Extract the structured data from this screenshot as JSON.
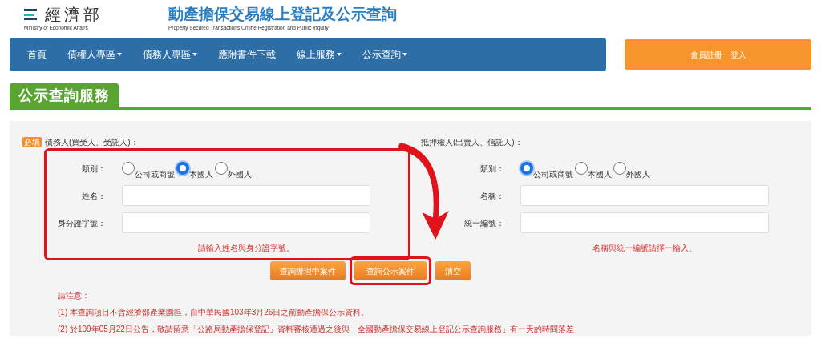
{
  "header": {
    "logo_name": "經濟部",
    "logo_en": "Ministry of Economic Affairs",
    "site_title": "動產擔保交易線上登記及公示查詢",
    "site_subtitle": "Property Secured Transactions Online Registration and Public Inquiry"
  },
  "nav": [
    {
      "label": "首頁",
      "dropdown": false
    },
    {
      "label": "債權人專區",
      "dropdown": true
    },
    {
      "label": "債務人專區",
      "dropdown": true
    },
    {
      "label": "應附書件下載",
      "dropdown": false
    },
    {
      "label": "線上服務",
      "dropdown": true
    },
    {
      "label": "公示查詢",
      "dropdown": true
    }
  ],
  "member_button": "會員註冊　登入",
  "section_title": "公示查詢服務",
  "parties": [
    {
      "heading": "債務人(買受人、受託人)：",
      "required_badge": "必填",
      "annotated": true,
      "type_label": "類別：",
      "types": [
        {
          "label": "公司或商號",
          "selected": false
        },
        {
          "label": "本國人",
          "selected": true
        },
        {
          "label": "外國人",
          "selected": false
        }
      ],
      "fields": [
        {
          "label": "姓名："
        },
        {
          "label": "身分證字號："
        }
      ],
      "hint": "請輸入姓名與身分證字號。"
    },
    {
      "heading": "抵押權人(出賣人、信託人)：",
      "annotated": false,
      "type_label": "類別：",
      "types": [
        {
          "label": "公司或商號",
          "selected": true
        },
        {
          "label": "本國人",
          "selected": false
        },
        {
          "label": "外國人",
          "selected": false
        }
      ],
      "fields": [
        {
          "label": "名稱："
        },
        {
          "label": "統一編號："
        }
      ],
      "hint": "名稱與統一編號請擇一輸入。"
    }
  ],
  "buttons": [
    {
      "label": "查詢辦理中案件",
      "annotated": false
    },
    {
      "label": "查詢公示案件",
      "annotated": true
    },
    {
      "label": "清空",
      "annotated": false
    }
  ],
  "notes": {
    "heading": "請注意：",
    "lines": [
      "(1) 本查詢項目不含經濟部產業園區，自中華民國103年3月26日之前動產擔保公示資料。",
      "(2) 於109年05月22日公告，敬請留意「公路局動產擔保登記」資料審核通過之後與　全國動產擔保交易線上登記公示查詢服務」有一天的時間落差"
    ]
  }
}
